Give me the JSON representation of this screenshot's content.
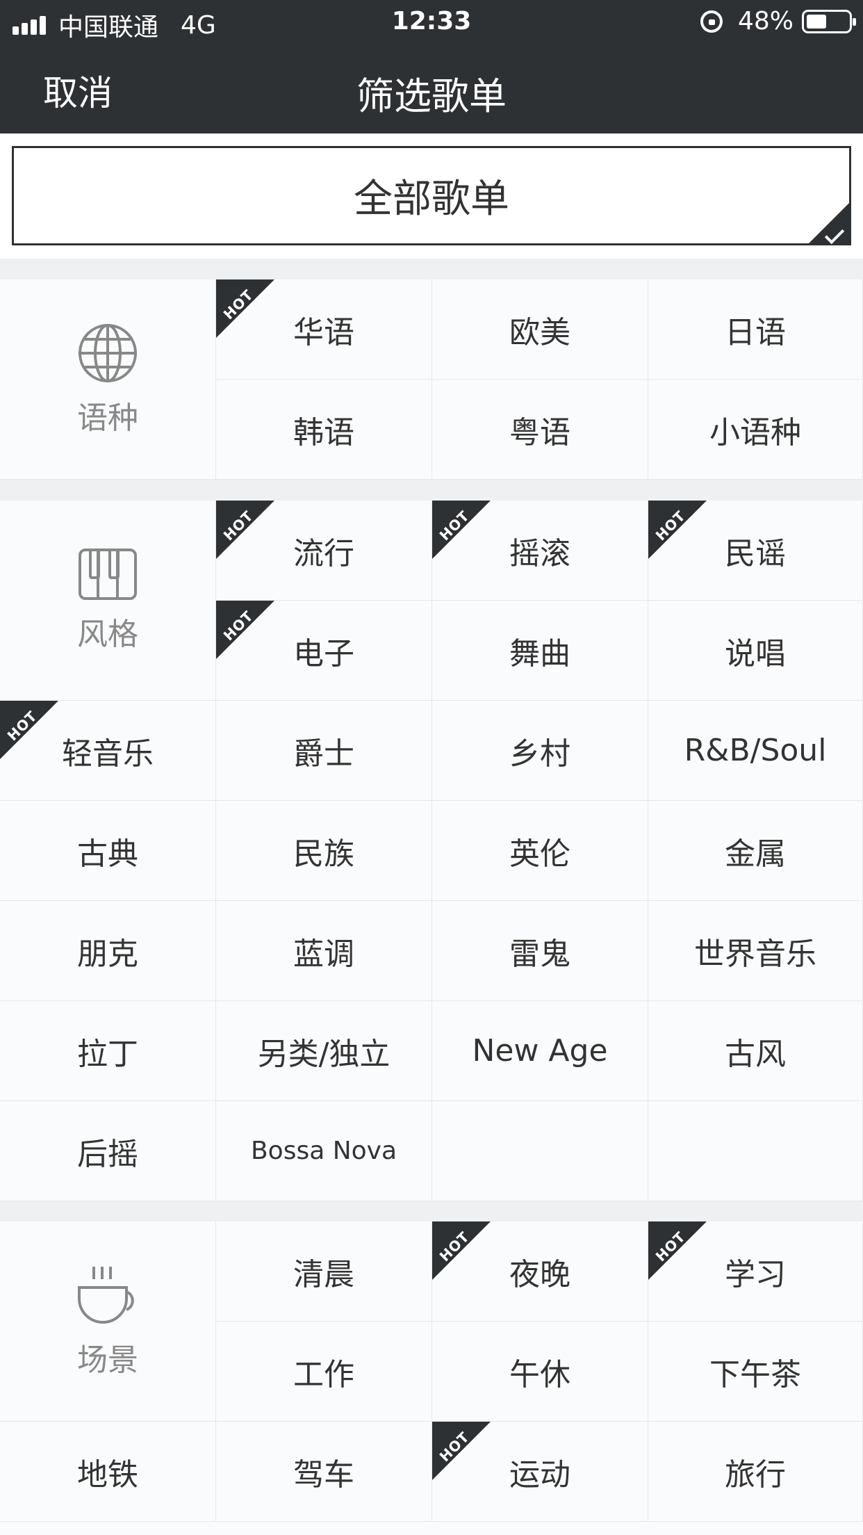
{
  "status_bar": {
    "carrier": "中国联通",
    "network": "4G",
    "time": "12:33",
    "battery": "48%",
    "battery_level": 0.48
  },
  "nav": {
    "cancel_label": "取消",
    "title": "筛选歌单"
  },
  "all_playlists": {
    "label": "全部歌单",
    "selected": true
  },
  "hot_badge": "HOT",
  "sections": {
    "language": {
      "label": "语种",
      "icon": "globe-icon",
      "items": [
        {
          "label": "华语",
          "hot": true
        },
        {
          "label": "欧美",
          "hot": false
        },
        {
          "label": "日语",
          "hot": false
        },
        {
          "label": "韩语",
          "hot": false
        },
        {
          "label": "粤语",
          "hot": false
        },
        {
          "label": "小语种",
          "hot": false
        }
      ]
    },
    "style": {
      "label": "风格",
      "icon": "piano-icon",
      "items": [
        {
          "label": "流行",
          "hot": true
        },
        {
          "label": "摇滚",
          "hot": true
        },
        {
          "label": "民谣",
          "hot": true
        },
        {
          "label": "电子",
          "hot": true
        },
        {
          "label": "舞曲",
          "hot": false
        },
        {
          "label": "说唱",
          "hot": false
        },
        {
          "label": "轻音乐",
          "hot": true
        },
        {
          "label": "爵士",
          "hot": false
        },
        {
          "label": "乡村",
          "hot": false
        },
        {
          "label": "R&B/Soul",
          "hot": false
        },
        {
          "label": "古典",
          "hot": false
        },
        {
          "label": "民族",
          "hot": false
        },
        {
          "label": "英伦",
          "hot": false
        },
        {
          "label": "金属",
          "hot": false
        },
        {
          "label": "朋克",
          "hot": false
        },
        {
          "label": "蓝调",
          "hot": false
        },
        {
          "label": "雷鬼",
          "hot": false
        },
        {
          "label": "世界音乐",
          "hot": false
        },
        {
          "label": "拉丁",
          "hot": false
        },
        {
          "label": "另类/独立",
          "hot": false
        },
        {
          "label": "New Age",
          "hot": false
        },
        {
          "label": "古风",
          "hot": false
        },
        {
          "label": "后摇",
          "hot": false
        },
        {
          "label": "Bossa Nova",
          "hot": false
        }
      ]
    },
    "scene": {
      "label": "场景",
      "icon": "coffee-cup-icon",
      "items": [
        {
          "label": "清晨",
          "hot": false
        },
        {
          "label": "夜晚",
          "hot": true
        },
        {
          "label": "学习",
          "hot": true
        },
        {
          "label": "工作",
          "hot": false
        },
        {
          "label": "午休",
          "hot": false
        },
        {
          "label": "下午茶",
          "hot": false
        },
        {
          "label": "地铁",
          "hot": false
        },
        {
          "label": "驾车",
          "hot": false
        },
        {
          "label": "运动",
          "hot": true
        },
        {
          "label": "旅行",
          "hot": false
        }
      ]
    }
  }
}
